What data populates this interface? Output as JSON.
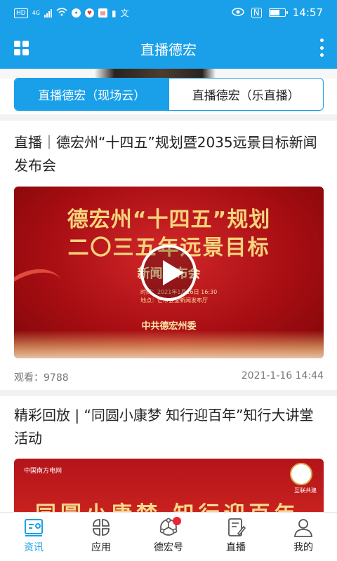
{
  "status_bar": {
    "time": "14:57",
    "network_label": "HD",
    "battery_level": 0.6,
    "left_icons": [
      "hd-icon",
      "signal-4g-icon",
      "signal-bars-icon",
      "wifi-icon",
      "app-notify-icon",
      "gift-icon",
      "book-icon",
      "alert-icon",
      "translate-icon"
    ],
    "right_icons": [
      "eye-icon",
      "nfc-icon",
      "battery-icon"
    ],
    "sim_label": "4G",
    "nfc_label": "N",
    "translate_label": "文"
  },
  "header": {
    "title": "直播德宏",
    "left_icon": "grid-menu-icon",
    "right_icon": "more-vertical-icon"
  },
  "tabs": [
    {
      "label": "直播德宏（现场云）",
      "active": true
    },
    {
      "label": "直播德宏（乐直播）",
      "active": false
    }
  ],
  "articles": [
    {
      "title": "直播｜德宏州“十四五”规划暨2035远景目标新闻发布会",
      "thumb": {
        "line1": "德宏州“十四五”规划",
        "line2": "二〇三五年远景目标",
        "line3": "新闻发布会",
        "meta_time": "时间：2021年1月16日 16:30",
        "meta_place": "地点：芒市会堂新闻发布厅",
        "org": "中共德宏州委"
      },
      "views_label": "观看：",
      "views": "9788",
      "date": "2021-1-16 14:44"
    },
    {
      "title": "精彩回放 | “同圆小康梦 知行迎百年”知行大讲堂活动",
      "thumb": {
        "logo": "中国南方电网",
        "seal_text": "互联共建",
        "big_text": "同圆小康梦 知行迎百年"
      }
    }
  ],
  "bottom_nav": [
    {
      "label": "资讯",
      "icon": "news-icon",
      "active": true
    },
    {
      "label": "应用",
      "icon": "apps-icon",
      "active": false
    },
    {
      "label": "德宏号",
      "icon": "network-icon",
      "active": false,
      "badge": true
    },
    {
      "label": "直播",
      "icon": "live-edit-icon",
      "active": false
    },
    {
      "label": "我的",
      "icon": "user-icon",
      "active": false
    }
  ],
  "colors": {
    "accent": "#1aa0e8",
    "badge": "#ee2233"
  }
}
